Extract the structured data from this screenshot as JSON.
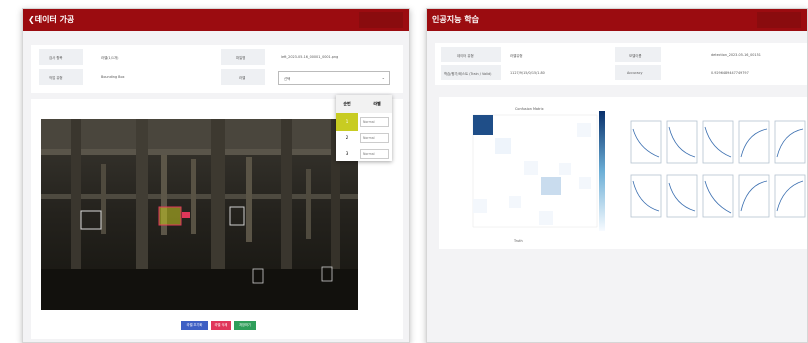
{
  "left": {
    "title": "❮데이터 가공",
    "info": {
      "label1": "검사 항목",
      "value1": "라벨(1/1개)",
      "label2": "작업 유형",
      "value2": "Bounding Box",
      "label3": "파일명",
      "value3": "left_2023-05-16_00001_0001.png",
      "label4": "라벨",
      "select_value": "선택"
    },
    "dropdown": {
      "col1": "순번",
      "col2": "라벨",
      "rows": [
        {
          "num": "1",
          "value": "Normal"
        },
        {
          "num": "2",
          "value": "Normal"
        },
        {
          "num": "3",
          "value": "Normal"
        }
      ]
    },
    "buttons": [
      "라벨 초기화",
      "라벨 삭제",
      "저장하기"
    ],
    "colors": {
      "primary": "#3d5fc4",
      "danger": "#e0365a",
      "success": "#2f9e5a",
      "highlight": "#c8cc22"
    }
  },
  "right": {
    "title": "인공지능 학습",
    "info": {
      "label1": "데이터 유형",
      "value1": "라벨유형",
      "label2": "모델이름",
      "value2": "detection_2023-05-16_00151",
      "label3": "학습/평가/테스트 (Train / Valid)",
      "value3": "1127/9/15/0/15/1.80",
      "label4": "Accuracy",
      "value4": "0.9296489447749797"
    },
    "matrix_title": "Confusion Matrix",
    "matrix_xlabel": "Truth",
    "metric_titles": [
      "train/box_loss",
      "train/obj_loss",
      "train/cls_loss",
      "metrics/precision",
      "metrics/recall",
      "val/box_loss",
      "val/obj_loss",
      "val/cls_loss",
      "metrics/mAP_0.5",
      "metrics/mAP_0.5:0.95"
    ]
  }
}
